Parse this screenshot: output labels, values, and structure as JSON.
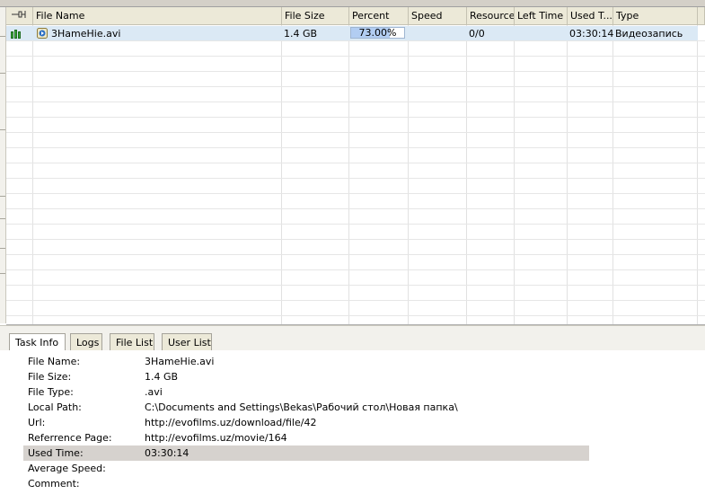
{
  "columns": {
    "file_name": "File Name",
    "file_size": "File Size",
    "percent": "Percent",
    "speed": "Speed",
    "resource": "Resource",
    "left_time": "Left Time",
    "used_time": "Used T...",
    "type": "Type"
  },
  "task": {
    "file_name": "3HameHie.avi",
    "file_size": "1.4 GB",
    "percent_text": "73.00%",
    "percent_value": 73,
    "resource": "0/0",
    "used_time": "03:30:14",
    "type": "Видеозапись"
  },
  "tabs": [
    "Task Info",
    "Logs",
    "File List",
    "User List"
  ],
  "task_info": [
    {
      "label": "File Name:",
      "value": "3HameHie.avi"
    },
    {
      "label": "File Size:",
      "value": "1.4 GB"
    },
    {
      "label": "File Type:",
      "value": ".avi"
    },
    {
      "label": "Local Path:",
      "value": "C:\\Documents and Settings\\Bekas\\Рабочий стол\\Новая папка\\"
    },
    {
      "label": "Url:",
      "value": "http://evofilms.uz/download/file/42"
    },
    {
      "label": "Referrence Page:",
      "value": "http://evofilms.uz/movie/164"
    },
    {
      "label": "Used Time:",
      "value": "03:30:14"
    },
    {
      "label": "Average Speed:",
      "value": ""
    },
    {
      "label": "Comment:",
      "value": ""
    }
  ],
  "colors": {
    "selection": "#dbe9f5",
    "progress": "#b2cdf2",
    "highlight_row": "#d6d2ce",
    "header_bg": "#ece9d8"
  },
  "icons": [
    "pin-icon",
    "downloading-status-icon",
    "media-file-icon"
  ]
}
